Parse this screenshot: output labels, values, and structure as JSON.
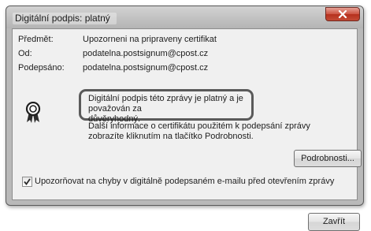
{
  "window": {
    "title": "Digitální podpis: platný"
  },
  "fields": [
    {
      "label": "Předmět:",
      "value": "Upozorneni na pripraveny certifikat"
    },
    {
      "label": "Od:",
      "value": "podatelna.postsignum@cpost.cz"
    },
    {
      "label": "Podepsáno:",
      "value": "podatelna.postsignum@cpost.cz"
    }
  ],
  "status": {
    "line1": "Digitální podpis této zprávy je platný a je považován za",
    "line2": "důvěryhodný."
  },
  "info": {
    "line1": "Další informace o certifikátu použitém k podepsání zprávy",
    "line2": "zobrazíte kliknutím na tlačítko Podrobnosti."
  },
  "buttons": {
    "details_label": "Podrobnosti...",
    "close_label": "Zavřít"
  },
  "checkbox": {
    "checked": true,
    "label": "Upozorňovat na chyby v digitálně podepsaném e-mailu před otevřením zprávy"
  },
  "icons": {
    "close": "close-icon",
    "certificate": "award-ribbon-icon",
    "check": "checkmark-icon"
  }
}
